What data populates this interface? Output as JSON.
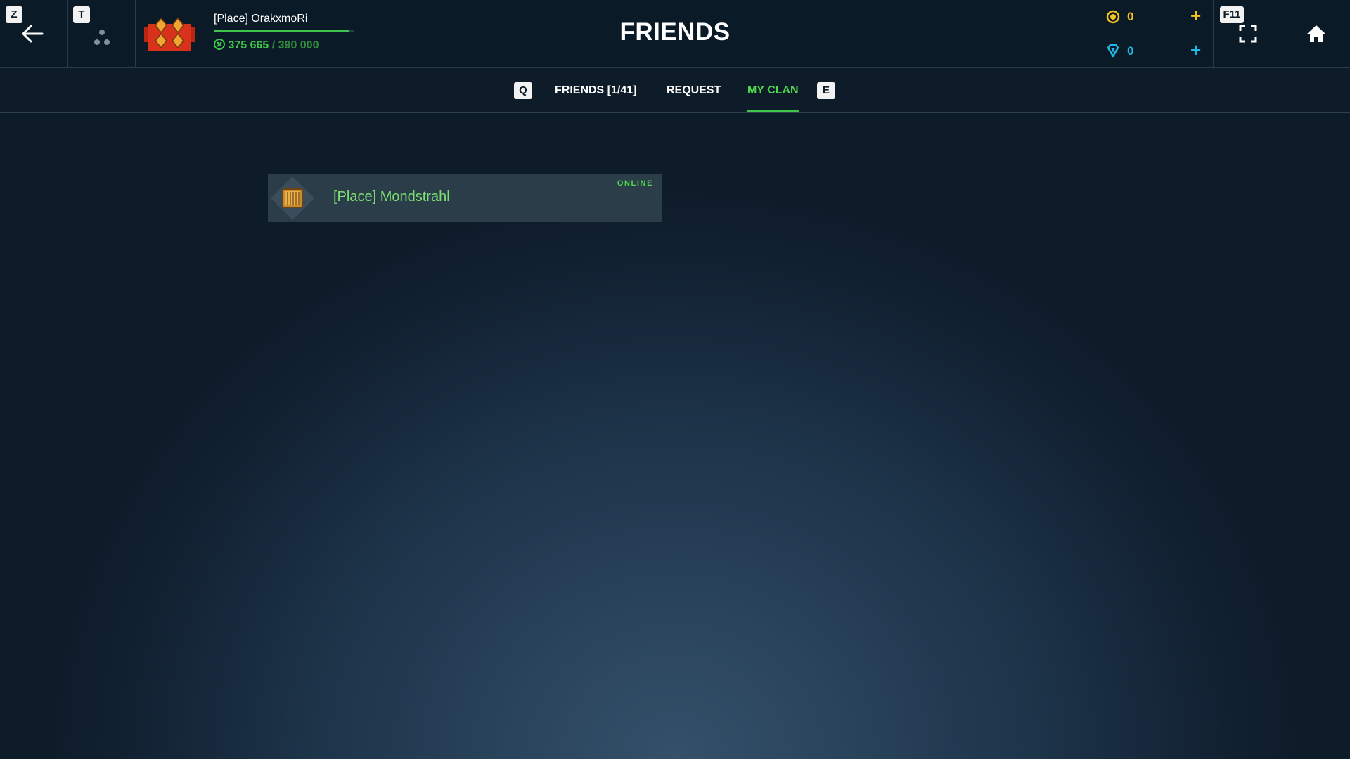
{
  "header": {
    "back_key": "Z",
    "social_key": "T",
    "fullscreen_key": "F11",
    "title": "FRIENDS"
  },
  "player": {
    "name": "[Place] OrakxmoRi",
    "xp_current": "375 665",
    "xp_separator": " / ",
    "xp_max": "390 000",
    "xp_progress": 0.963,
    "badge_icon": "red-clan-emblem-icon"
  },
  "currencies": {
    "gold": {
      "value": "0",
      "color": "#f2c21d",
      "icon": "coin-icon"
    },
    "gems": {
      "value": "0",
      "color": "#23b7e5",
      "icon": "gem-icon"
    }
  },
  "tabs": {
    "prev_key": "Q",
    "next_key": "E",
    "items": [
      {
        "label": "FRIENDS [1/41]",
        "active": false
      },
      {
        "label": "REQUEST",
        "active": false
      },
      {
        "label": "MY CLAN",
        "active": true
      }
    ]
  },
  "clan_members": [
    {
      "name": "[Place] Mondstrahl",
      "status": "ONLINE",
      "rank_icon": "bronze-rank-icon"
    }
  ],
  "colors": {
    "accent_green": "#3ec64a",
    "header_bg": "#0b1a27"
  }
}
